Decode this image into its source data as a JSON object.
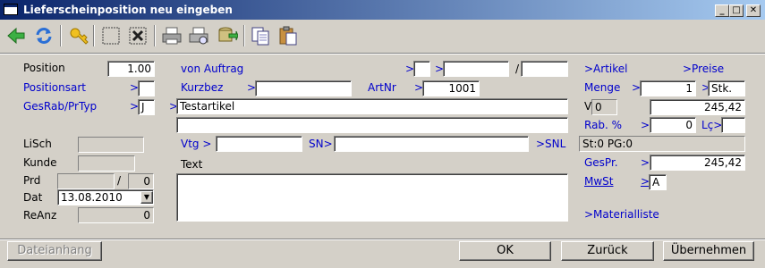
{
  "window": {
    "title": "Lieferscheinposition neu eingeben",
    "minimize": "_",
    "maximize": "□",
    "close": "✕"
  },
  "toolbar": {
    "icons": [
      "back-arrow-icon",
      "refresh-icon",
      "key-icon",
      "select-frame-icon",
      "delete-frame-icon",
      "print-icon",
      "print-preview-icon",
      "export-icon",
      "copy-icon",
      "paste-icon"
    ]
  },
  "form": {
    "position_label": "Position",
    "position_value": "1.00",
    "positionsart_label": "Positionsart",
    "positionsart_prefix": ">",
    "positionsart_value": "",
    "gesrab_label": "GesRab/PrTyp",
    "gesrab_prefix": ">",
    "gesrab_value": "J",
    "von_auftrag_label": "von Auftrag",
    "auftrag_prefix1": ">",
    "auftrag_prefix2": ">",
    "auftrag_slash": "/",
    "auftrag_value1": "",
    "auftrag_value2": "",
    "auftrag_value3": "",
    "kurzbez_label": "Kurzbez",
    "kurzbez_prefix": ">",
    "kurzbez_value": "",
    "artnr_label": "ArtNr",
    "artnr_prefix": ">",
    "artnr_value": "1001",
    "bez_prefix": ">",
    "bez_value": "Testartikel",
    "bez2_value": "",
    "lisch_label": "LiSch",
    "lisch_value": "",
    "kunde_label": "Kunde",
    "kunde_value": "",
    "prd_label": "Prd",
    "prd_value1": "",
    "prd_slash": "/",
    "prd_value2": "0",
    "dat_label": "Dat",
    "dat_value": "13.08.2010",
    "reanz_label": "ReAnz",
    "reanz_value": "0",
    "vtg_label": "Vtg >",
    "vtg_value": "",
    "sn_label": "SN>",
    "sn_value": "",
    "snl_label": ">SNL",
    "text_label": "Text",
    "text_value": ""
  },
  "right": {
    "artikel_label": ">Artikel",
    "preise_label": ">Preise",
    "menge_label": "Menge",
    "menge_prefix": ">",
    "menge_value": "1",
    "unit_prefix": ">",
    "unit_value": "Stk.",
    "v_label": "V",
    "v_value": "0",
    "v_price": "245,42",
    "rab_label": "Rab. %",
    "rab_prefix": ">",
    "rab_value": "0",
    "lp_label": "Lç>",
    "lp_value": "",
    "st_info": "St:0 PG:0",
    "gespr_label": "GesPr.",
    "gespr_prefix": ">",
    "gespr_value": "245,42",
    "mwst_label": "MwSt",
    "mwst_prefix": ">",
    "mwst_value": "A",
    "materialliste_label": ">Materialliste"
  },
  "buttons": {
    "attachment": "Dateianhang",
    "ok": "OK",
    "back": "Zurück",
    "accept": "Übernehmen"
  }
}
